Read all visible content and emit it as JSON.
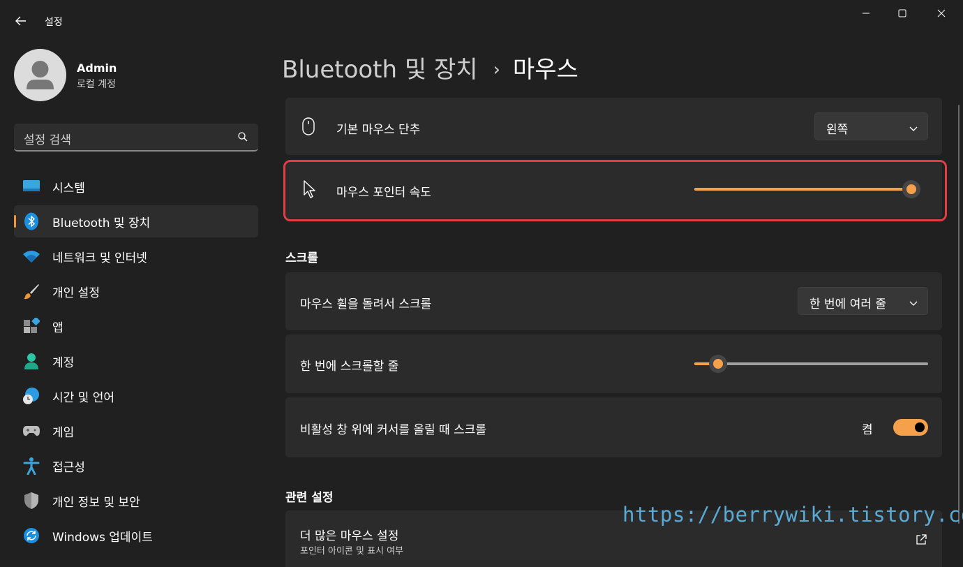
{
  "app": {
    "title": "설정"
  },
  "user": {
    "name": "Admin",
    "type": "로컬 계정"
  },
  "search": {
    "placeholder": "설정 검색"
  },
  "nav": {
    "items": [
      {
        "label": "시스템",
        "icon": "system-icon"
      },
      {
        "label": "Bluetooth 및 장치",
        "icon": "bluetooth-icon",
        "active": true
      },
      {
        "label": "네트워크 및 인터넷",
        "icon": "wifi-icon"
      },
      {
        "label": "개인 설정",
        "icon": "brush-icon"
      },
      {
        "label": "앱",
        "icon": "apps-icon"
      },
      {
        "label": "계정",
        "icon": "account-icon"
      },
      {
        "label": "시간 및 언어",
        "icon": "globe-clock-icon"
      },
      {
        "label": "게임",
        "icon": "gamepad-icon"
      },
      {
        "label": "접근성",
        "icon": "accessibility-icon"
      },
      {
        "label": "개인 정보 및 보안",
        "icon": "shield-icon"
      },
      {
        "label": "Windows 업데이트",
        "icon": "update-icon"
      }
    ]
  },
  "breadcrumb": {
    "parent": "Bluetooth 및 장치",
    "separator": "›",
    "current": "마우스"
  },
  "settings": {
    "primary_button": {
      "label": "기본 마우스 단추",
      "value": "왼쪽"
    },
    "pointer_speed": {
      "label": "마우스 포인터 속도",
      "value_fraction": 1.0
    }
  },
  "scroll_section": {
    "title": "스크롤",
    "wheel_scroll": {
      "label": "마우스 휠을 돌려서 스크롤",
      "value": "한 번에 여러 줄"
    },
    "lines_per_scroll": {
      "label": "한 번에 스크롤할 줄",
      "value_fraction": 0.1
    },
    "inactive_scroll": {
      "label": "비활성 창 위에 커서를 올릴 때 스크롤",
      "state": "켬",
      "on": true
    }
  },
  "related": {
    "title": "관련 설정",
    "more_mouse": {
      "label": "더 많은 마우스 설정",
      "sub": "포인터 아이콘 및 표시 여부"
    }
  },
  "watermark": "https://berrywiki.tistory.com",
  "colors": {
    "accent": "#f5a04a",
    "highlight": "#e23c45",
    "background": "#202020",
    "card": "#2b2b2b"
  }
}
